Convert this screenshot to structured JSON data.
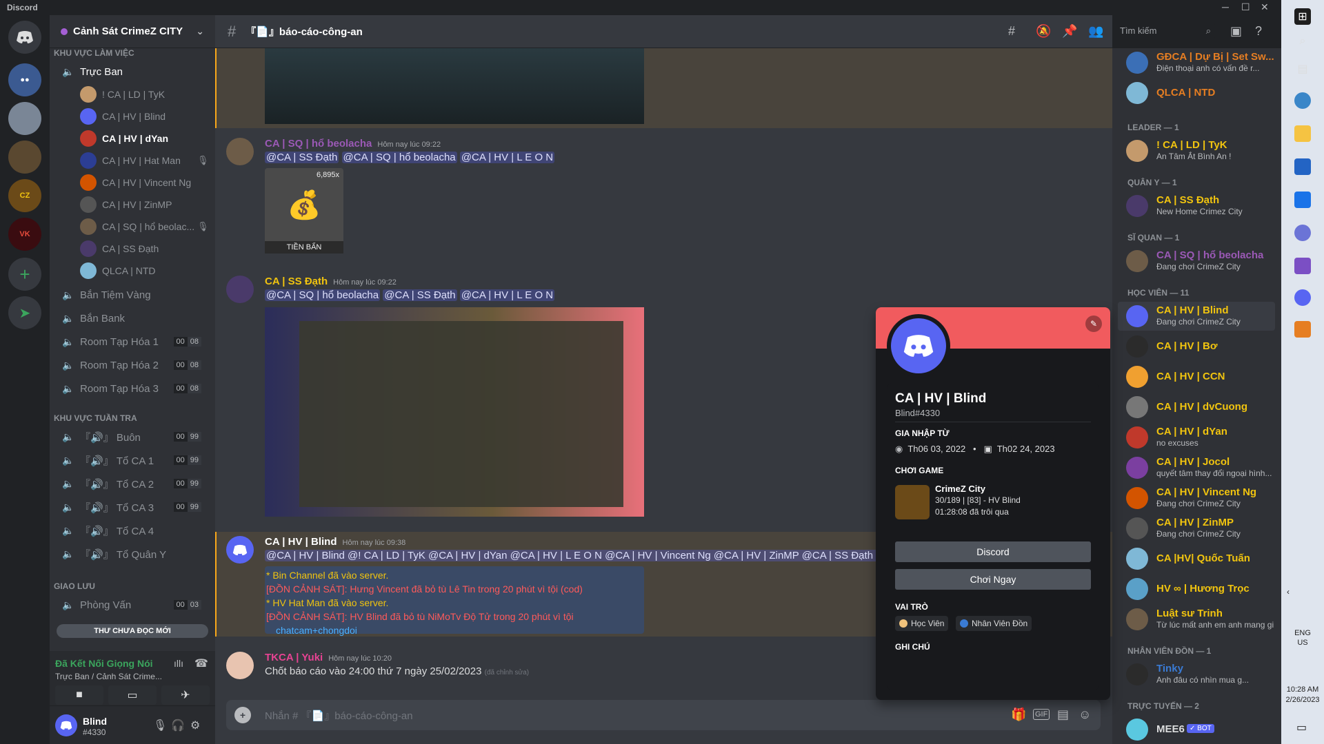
{
  "app_title": "Discord",
  "server": {
    "name": "Cảnh Sát CrimeZ CITY"
  },
  "channel": {
    "name": "『📄』báo-cáo-công-an",
    "search_placeholder": "Tìm kiếm",
    "composer_placeholder": "Nhắn # 『📄』báo-cáo-công-an"
  },
  "sidebar": {
    "cat_top": "KHU VỰC LÀM VIỆC",
    "truc_ban": "Trực Ban",
    "voice_users": [
      "! CA | LD | TyK",
      "CA | HV | Blind",
      "CA | HV | dYan",
      "CA | HV | Hat Man",
      "CA | HV | Vincent Ng",
      "CA | HV | ZinMP",
      "CA | SQ | hổ beolac...",
      "CA | SS Đạth",
      "QLCA | NTD"
    ],
    "ch1": "Bắn Tiệm Vàng",
    "ch2": "Bắn Bank",
    "rooms": [
      {
        "name": "Room Tạp Hóa 1",
        "a": "00",
        "b": "08"
      },
      {
        "name": "Room Tạp Hóa 2",
        "a": "00",
        "b": "08"
      },
      {
        "name": "Room Tạp Hóa 3",
        "a": "00",
        "b": "08"
      }
    ],
    "cat_patrol": "KHU VỰC TUẦN TRA",
    "patrol": [
      {
        "name": "『🔊』 Buôn",
        "a": "00",
        "b": "99"
      },
      {
        "name": "『🔊』 Tổ CA 1",
        "a": "00",
        "b": "99"
      },
      {
        "name": "『🔊』 Tổ CA 2",
        "a": "00",
        "b": "99"
      },
      {
        "name": "『🔊』 Tổ CA 3",
        "a": "00",
        "b": "99"
      },
      {
        "name": "『🔊』 Tổ CA 4"
      },
      {
        "name": "『🔊』 Tổ Quân Y"
      }
    ],
    "cat_social": "GIAO LƯU",
    "phong_van": {
      "name": "Phòng Vấn",
      "a": "00",
      "b": "03"
    },
    "unread": "THƯ CHƯA ĐỌC MỚI",
    "voice_status": "Đã Kết Nối Giọng Nói",
    "voice_sub": "Trực Ban / Cảnh Sát Crime...",
    "user": {
      "name": "Blind",
      "tag": "#4330"
    }
  },
  "messages": [
    {
      "author": "CA | SQ | hổ beolacha",
      "time": "Hôm nay lúc 09:22",
      "mentions": [
        "@CA | SS Đạth",
        "@CA | SQ | hổ beolacha",
        "@CA | HV | L E O N"
      ],
      "item_count": "6,895x",
      "item_label": "TIỀN BẨN"
    },
    {
      "author": "CA | SS Đạth",
      "time": "Hôm nay lúc 09:22",
      "mentions": [
        "@CA | SQ | hổ beolacha",
        "@CA | SS Đạth",
        "@CA | HV | L E O N"
      ]
    },
    {
      "author": "CA | HV | Blind",
      "time": "Hôm nay lúc 09:38",
      "text": "@CA | HV | Blind @! CA | LD | TyK @CA | HV | dYan @CA | HV | L E O N @CA | HV | Vincent Ng @CA | HV | ZinMP @CA | SS Đạth @",
      "log": [
        "* Bin Channel đã vào server.",
        "[ĐỒN CẢNH SÁT]: Hưng Vincent đã bỏ tù Lê Tin trong 20 phút vì tội (cod)",
        "* HV Hat Man đã vào server.",
        "[ĐỒN CẢNH SÁT]: HV Blind đã bỏ tù NiMoTv Độ Tử trong 20 phút vì tội",
        "chatcam+chongdoi"
      ]
    },
    {
      "author": "TKCA | Yuki",
      "time": "Hôm nay lúc 10:20",
      "text": "Chốt báo cáo vào 24:00 thứ 7 ngày 25/02/2023",
      "edited": "(đã chỉnh sửa)"
    }
  ],
  "popout": {
    "name": "CA | HV | Blind",
    "tag": "Blind#4330",
    "join_label": "GIA NHẬP TỪ",
    "join_discord": "Th06 03, 2022",
    "join_server": "Th02 24, 2023",
    "game_label": "CHƠI GAME",
    "game_name": "CrimeZ City",
    "game_detail": "30/189 | [83] - HV Blind",
    "game_elapsed": "01:28:08 đã trôi qua",
    "btn1": "Discord",
    "btn2": "Chơi Ngay",
    "roles_label": "VAI TRÒ",
    "roles": [
      {
        "name": "Học Viên",
        "color": "#f0c27b"
      },
      {
        "name": "Nhân Viên Đồn",
        "color": "#3a7bd5"
      }
    ],
    "note_label": "GHI CHÚ"
  },
  "members": {
    "top": [
      {
        "name": "GĐCA | Dự Bị | Set Sw...",
        "status": "Điện thoại anh có vấn đề r...",
        "color": "#e67e22"
      },
      {
        "name": "QLCA | NTD",
        "color": "#e67e22"
      }
    ],
    "leader_label": "LEADER — 1",
    "leader": [
      {
        "name": "! CA | LD | TyK",
        "status": "An Tâm Ắt Bình An !",
        "color": "#f1c40f"
      }
    ],
    "quany_label": "QUÂN Y — 1",
    "quany": [
      {
        "name": "CA | SS Đạth",
        "status": "New Home Crimez City",
        "color": "#f1c40f"
      }
    ],
    "siquan_label": "SĨ QUAN — 1",
    "siquan": [
      {
        "name": "CA | SQ | hổ beolacha",
        "status": "Đang chơi CrimeZ City",
        "color": "#9b59b6"
      }
    ],
    "hocvien_label": "HỌC VIÊN — 11",
    "hocvien": [
      {
        "name": "CA | HV | Blind",
        "status": "Đang chơi CrimeZ City"
      },
      {
        "name": "CA | HV | Bơ"
      },
      {
        "name": "CA | HV | CCN"
      },
      {
        "name": "CA | HV | dvCuong"
      },
      {
        "name": "CA | HV | dYan",
        "status": "no excuses"
      },
      {
        "name": "CA | HV | Jocol",
        "status": "quyết tâm thay đổi ngoại hình..."
      },
      {
        "name": "CA | HV | Vincent Ng",
        "status": "Đang chơi CrimeZ City"
      },
      {
        "name": "CA | HV | ZinMP",
        "status": "Đang chơi CrimeZ City"
      },
      {
        "name": "CA |HV| Quốc Tuấn"
      },
      {
        "name": "HV ∞ | Hương Trọc"
      },
      {
        "name": "Luật sư Trinh",
        "status": "Từ lúc mất anh em anh mang gi..."
      }
    ],
    "nvd_label": "NHÂN VIÊN ĐỒN — 1",
    "nvd": [
      {
        "name": "Tinky",
        "status": "Anh đâu có nhìn mua g..."
      }
    ],
    "online_label": "TRỰC TUYẾN — 2",
    "online": [
      {
        "name": "MEE6",
        "badge": "✓ BOT"
      }
    ]
  },
  "taskbar": {
    "lang1": "ENG",
    "lang2": "US",
    "time": "10:28 AM",
    "date": "2/26/2023"
  }
}
